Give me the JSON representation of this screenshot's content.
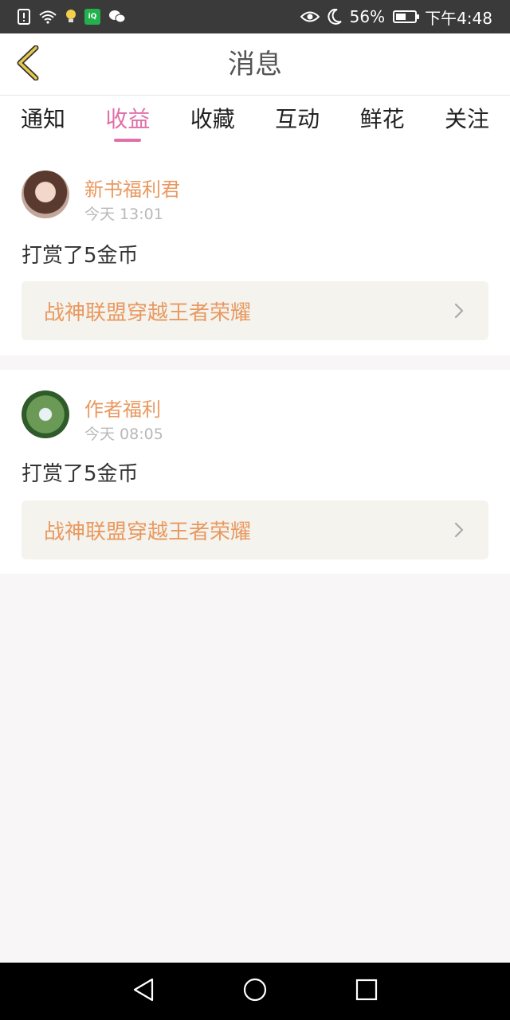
{
  "status_bar": {
    "left_icons": [
      "sim-alert-icon",
      "wifi-icon",
      "lightbulb-icon",
      "iqiyi-icon",
      "wechat-icon"
    ],
    "eye_icon": "eye-icon",
    "moon_icon": "moon-icon",
    "battery_percent": "56%",
    "battery_level": 0.56,
    "time": "下午4:48"
  },
  "header": {
    "title": "消息",
    "back_icon": "chevron-left-icon",
    "back_color": "#e6c84a"
  },
  "tabs": [
    {
      "label": "通知",
      "active": false
    },
    {
      "label": "收益",
      "active": true
    },
    {
      "label": "收藏",
      "active": false
    },
    {
      "label": "互动",
      "active": false
    },
    {
      "label": "鲜花",
      "active": false
    },
    {
      "label": "关注",
      "active": false
    }
  ],
  "accent_color": "#e070a8",
  "messages": [
    {
      "sender": "新书福利君",
      "time": "今天 13:01",
      "text": "打赏了5金币",
      "book_title": "战神联盟穿越王者荣耀"
    },
    {
      "sender": "作者福利",
      "time": "今天 08:05",
      "text": "打赏了5金币",
      "book_title": "战神联盟穿越王者荣耀"
    }
  ],
  "nav_bar": {
    "back": "triangle-back-icon",
    "home": "circle-home-icon",
    "recent": "square-recents-icon"
  }
}
